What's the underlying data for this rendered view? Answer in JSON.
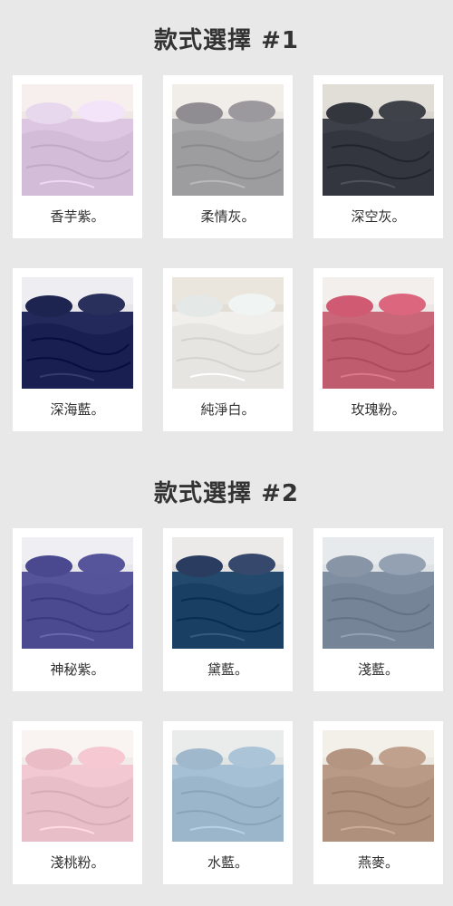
{
  "sections": [
    {
      "title": "款式選擇 #1",
      "items": [
        {
          "label": "香芋紫。",
          "color": "#dcc6e2",
          "pillow": "#e8d8ee",
          "bg": "#efe7e5"
        },
        {
          "label": "柔情灰。",
          "color": "#a7a6a8",
          "pillow": "#8f8d92",
          "bg": "#e9e6e1"
        },
        {
          "label": "深空灰。",
          "color": "#3d4048",
          "pillow": "#33363d",
          "bg": "#d9d6d0"
        },
        {
          "label": "深海藍。",
          "color": "#23295a",
          "pillow": "#1e2450",
          "bg": "#e6e6ea"
        },
        {
          "label": "純淨白。",
          "color": "#f1efec",
          "pillow": "#e4e8e6",
          "bg": "#e2ddd5"
        },
        {
          "label": "玫瑰粉。",
          "color": "#c96677",
          "pillow": "#d15a73",
          "bg": "#eae7e4"
        }
      ]
    },
    {
      "title": "款式選擇 #2",
      "items": [
        {
          "label": "神秘紫。",
          "color": "#55549a",
          "pillow": "#4a4990",
          "bg": "#e7e6ea"
        },
        {
          "label": "黛藍。",
          "color": "#234a6c",
          "pillow": "#2a3d60",
          "bg": "#e3e2e0"
        },
        {
          "label": "淺藍。",
          "color": "#7f8ea0",
          "pillow": "#8795a7",
          "bg": "#dfe2e4"
        },
        {
          "label": "淺桃粉。",
          "color": "#f2c9d2",
          "pillow": "#eabcc6",
          "bg": "#f1ecea"
        },
        {
          "label": "水藍。",
          "color": "#a5bfd4",
          "pillow": "#9fb8cc",
          "bg": "#e2e4e3"
        },
        {
          "label": "燕麥。",
          "color": "#b89a87",
          "pillow": "#b49582",
          "bg": "#ebe7e1"
        }
      ]
    }
  ]
}
